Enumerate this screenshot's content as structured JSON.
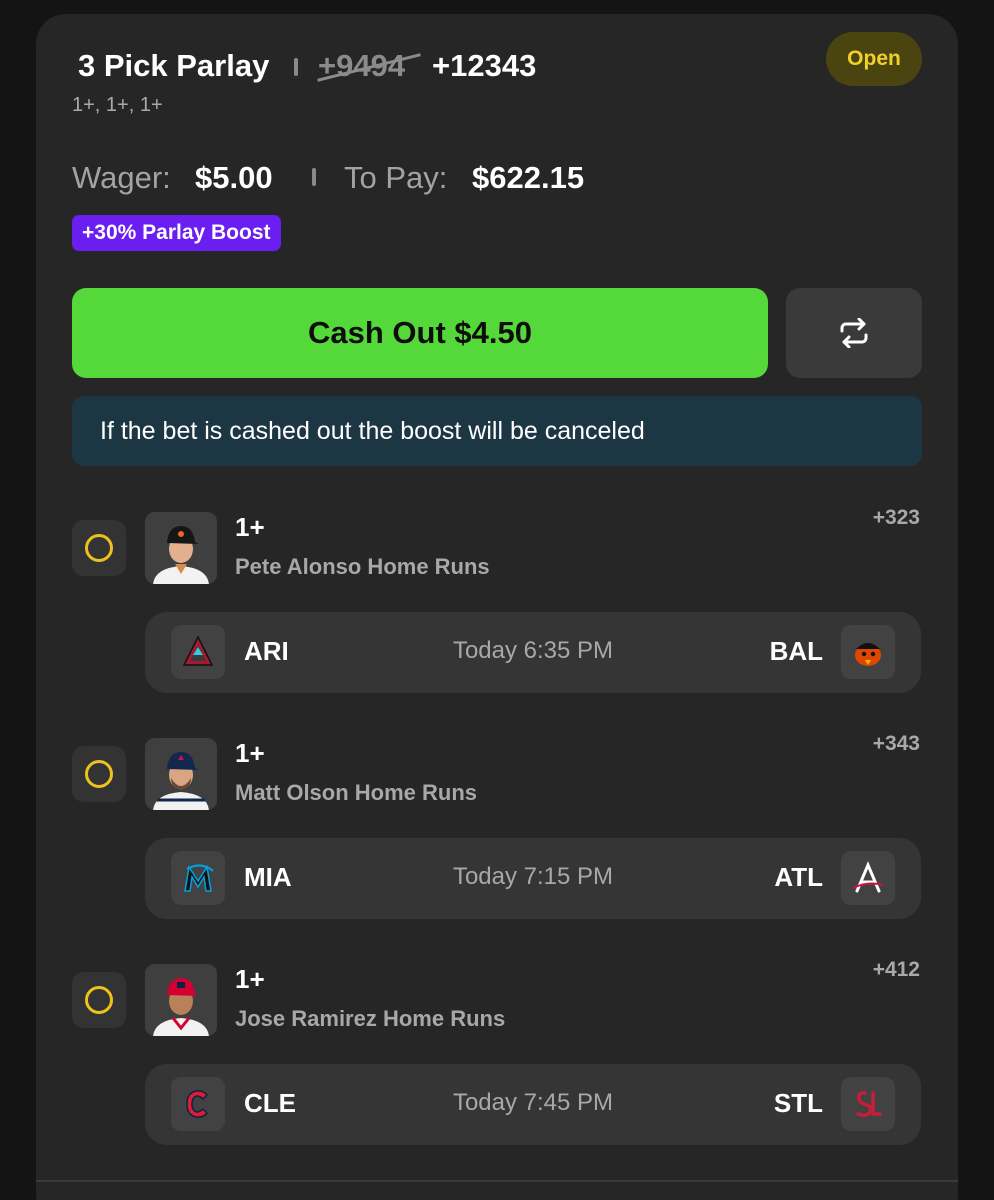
{
  "bet": {
    "title": "3 Pick Parlay",
    "old_odds": "+9494",
    "new_odds": "+12343",
    "subtitle": "1+, 1+, 1+",
    "status": "Open",
    "wager_label": "Wager:",
    "wager_value": "$5.00",
    "topay_label": "To Pay:",
    "topay_value": "$622.15",
    "boost_label": "+30% Parlay Boost",
    "cashout_label": "Cash Out $4.50",
    "notice": "If the bet is cashed out the boost will be canceled"
  },
  "picks": [
    {
      "line": "1+",
      "description": "Pete Alonso Home Runs",
      "odds": "+323",
      "away_team": "ARI",
      "home_team": "BAL",
      "game_time": "Today 6:35 PM",
      "away_logo_icon": "diamondbacks-logo-icon",
      "home_logo_icon": "orioles-logo-icon"
    },
    {
      "line": "1+",
      "description": "Matt Olson Home Runs",
      "odds": "+343",
      "away_team": "MIA",
      "home_team": "ATL",
      "game_time": "Today 7:15 PM",
      "away_logo_icon": "marlins-logo-icon",
      "home_logo_icon": "braves-logo-icon"
    },
    {
      "line": "1+",
      "description": "Jose Ramirez Home Runs",
      "odds": "+412",
      "away_team": "CLE",
      "home_team": "STL",
      "game_time": "Today 7:45 PM",
      "away_logo_icon": "guardians-logo-icon",
      "home_logo_icon": "cardinals-logo-icon"
    }
  ],
  "icons": {
    "refresh": "refresh-icon",
    "pick_status": "pending-circle-icon"
  },
  "colors": {
    "cashout_green": "#55d83a",
    "boost_purple": "#6a1ef0",
    "open_yellow": "#f2d02c",
    "notice_blue": "#1d3644",
    "pending_ring": "#ecc21e"
  }
}
